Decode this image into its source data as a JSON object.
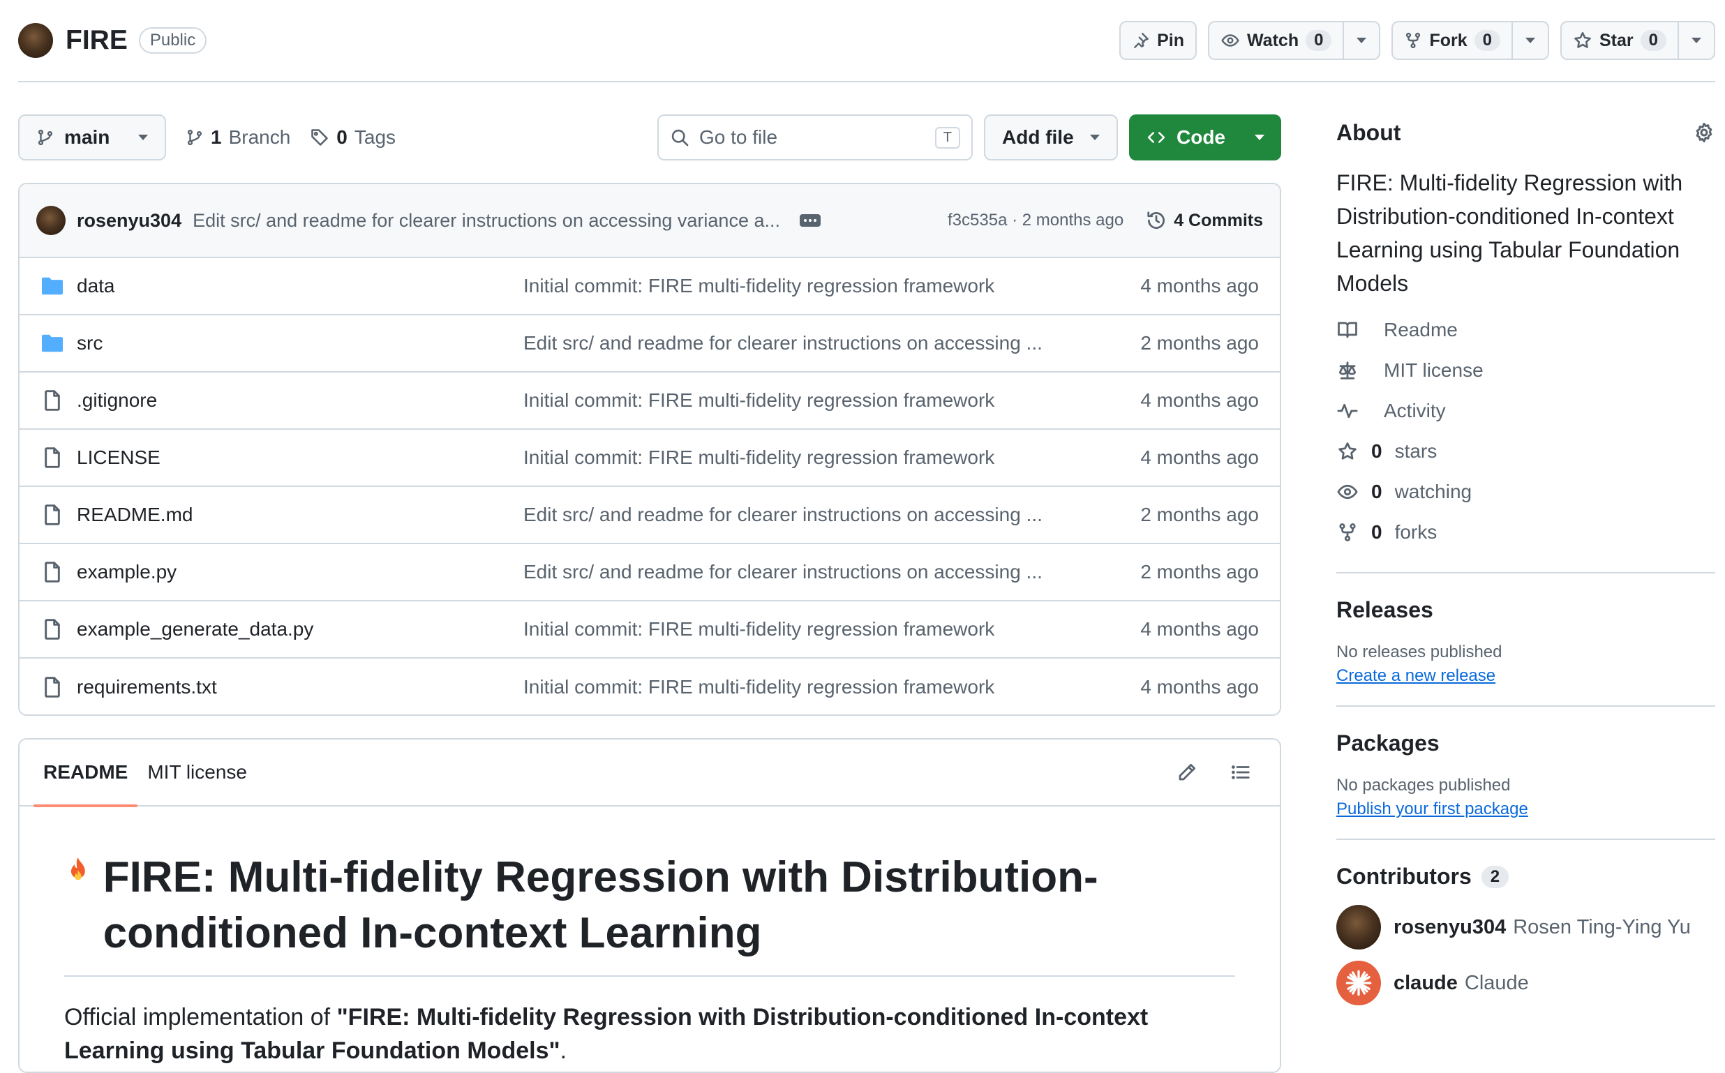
{
  "repo": {
    "name": "FIRE",
    "visibility": "Public"
  },
  "actions": {
    "pin_label": "Pin",
    "watch_label": "Watch",
    "watch_count": "0",
    "fork_label": "Fork",
    "fork_count": "0",
    "star_label": "Star",
    "star_count": "0"
  },
  "toolbar": {
    "branch": "main",
    "branches_count": "1",
    "branches_label": "Branch",
    "tags_count": "0",
    "tags_label": "Tags",
    "goto_placeholder": "Go to file",
    "goto_shortcut": "T",
    "add_file_label": "Add file",
    "code_label": "Code"
  },
  "latest_commit": {
    "author": "rosenyu304",
    "message": "Edit src/ and readme for clearer instructions on accessing variance a...",
    "hash_time": "f3c535a · 2 months ago",
    "commits_label": "4 Commits"
  },
  "files": [
    {
      "name": "data",
      "type": "folder",
      "message": "Initial commit: FIRE multi-fidelity regression framework",
      "date": "4 months ago"
    },
    {
      "name": "src",
      "type": "folder",
      "message": "Edit src/ and readme for clearer instructions on accessing ...",
      "date": "2 months ago"
    },
    {
      "name": ".gitignore",
      "type": "file",
      "message": "Initial commit: FIRE multi-fidelity regression framework",
      "date": "4 months ago"
    },
    {
      "name": "LICENSE",
      "type": "file",
      "message": "Initial commit: FIRE multi-fidelity regression framework",
      "date": "4 months ago"
    },
    {
      "name": "README.md",
      "type": "file",
      "message": "Edit src/ and readme for clearer instructions on accessing ...",
      "date": "2 months ago"
    },
    {
      "name": "example.py",
      "type": "file",
      "message": "Edit src/ and readme for clearer instructions on accessing ...",
      "date": "2 months ago"
    },
    {
      "name": "example_generate_data.py",
      "type": "file",
      "message": "Initial commit: FIRE multi-fidelity regression framework",
      "date": "4 months ago"
    },
    {
      "name": "requirements.txt",
      "type": "file",
      "message": "Initial commit: FIRE multi-fidelity regression framework",
      "date": "4 months ago"
    }
  ],
  "readme": {
    "tabs": [
      "README",
      "MIT license"
    ],
    "title": "FIRE: Multi-fidelity Regression with Distribution-conditioned In-context Learning",
    "intro_prefix": "Official implementation of ",
    "intro_bold": "\"FIRE: Multi-fidelity Regression with Distribution-conditioned In-context Learning using Tabular Foundation Models\"",
    "intro_suffix": "."
  },
  "sidebar": {
    "about_title": "About",
    "description": "FIRE: Multi-fidelity Regression with Distribution-conditioned In-context Learning using Tabular Foundation Models",
    "links": [
      {
        "icon": "book-icon",
        "bold": "",
        "label": "Readme"
      },
      {
        "icon": "law-icon",
        "bold": "",
        "label": "MIT license"
      },
      {
        "icon": "pulse-icon",
        "bold": "",
        "label": "Activity"
      },
      {
        "icon": "star-icon",
        "bold": "0",
        "label": "stars"
      },
      {
        "icon": "eye-icon",
        "bold": "0",
        "label": "watching"
      },
      {
        "icon": "fork-icon",
        "bold": "0",
        "label": "forks"
      }
    ],
    "releases_title": "Releases",
    "releases_empty": "No releases published",
    "releases_link": "Create a new release",
    "packages_title": "Packages",
    "packages_empty": "No packages published",
    "packages_link": "Publish your first package",
    "contributors_title": "Contributors",
    "contributors_count": "2",
    "contributors": [
      {
        "login": "rosenyu304",
        "name": "Rosen Ting-Ying Yu"
      },
      {
        "login": "claude",
        "name": "Claude"
      }
    ]
  },
  "colors": {
    "accent_green": "#1f883d",
    "link_blue": "#0969da",
    "tab_underline": "#fd8c73",
    "folder_blue": "#54aeff"
  }
}
